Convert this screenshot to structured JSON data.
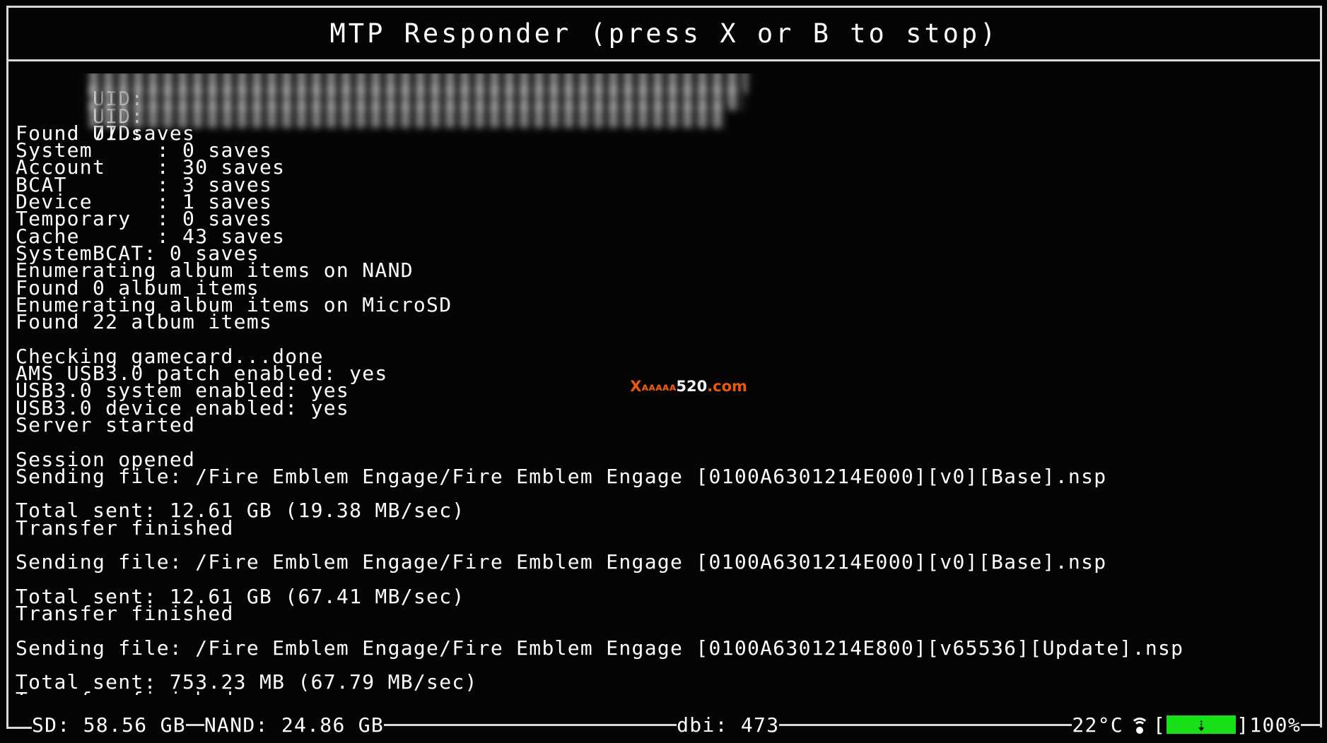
{
  "window": {
    "title": "MTP Responder (press X or B to stop)"
  },
  "colors": {
    "background": "#050505",
    "foreground": "#ffffff",
    "border": "#d8d8d8",
    "battery_green": "#17e017",
    "watermark_orange": "#e8590c",
    "watermark_white": "#f2f2f2"
  },
  "console": {
    "uid_rows": [
      {
        "label": "UID:",
        "value": ""
      },
      {
        "label": "UID:",
        "value": ""
      },
      {
        "label": "UID:",
        "value": ""
      }
    ],
    "lines": [
      "Found 77 saves",
      "System     : 0 saves",
      "Account    : 30 saves",
      "BCAT       : 3 saves",
      "Device     : 1 saves",
      "Temporary  : 0 saves",
      "Cache      : 43 saves",
      "SystemBCAT: 0 saves",
      "Enumerating album items on NAND",
      "Found 0 album items",
      "Enumerating album items on MicroSD",
      "Found 22 album items",
      "",
      "Checking gamecard...done",
      "AMS USB3.0 patch enabled: yes",
      "USB3.0 system enabled: yes",
      "USB3.0 device enabled: yes",
      "Server started",
      "",
      "Session opened",
      "Sending file: /Fire Emblem Engage/Fire Emblem Engage [0100A6301214E000][v0][Base].nsp",
      "Total sent: 12.61 GB (19.38 MB/sec)",
      "Transfer finished",
      "",
      "Sending file: /Fire Emblem Engage/Fire Emblem Engage [0100A6301214E000][v0][Base].nsp",
      "Total sent: 12.61 GB (67.41 MB/sec)",
      "Transfer finished",
      "",
      "Sending file: /Fire Emblem Engage/Fire Emblem Engage [0100A6301214E800][v65536][Update].nsp",
      "Total sent: 753.23 MB (67.79 MB/sec)",
      "Transfer finished"
    ]
  },
  "watermark": {
    "prefix": "X",
    "small": "ᴀᴀᴀᴀᴀ",
    "digits": "520",
    "suffix": ".com"
  },
  "statusbar": {
    "sd_label": "SD: 58.56 GB",
    "nand_label": "NAND: 24.86 GB",
    "dbi_label": "dbi: 473",
    "temperature": "22°C",
    "wifi_icon": "wifi-icon",
    "battery_icon": "battery-charging-icon",
    "battery_bracket_open": "[",
    "battery_bracket_close": "]",
    "battery_bolt": "⇣",
    "battery_percent": "100%"
  }
}
